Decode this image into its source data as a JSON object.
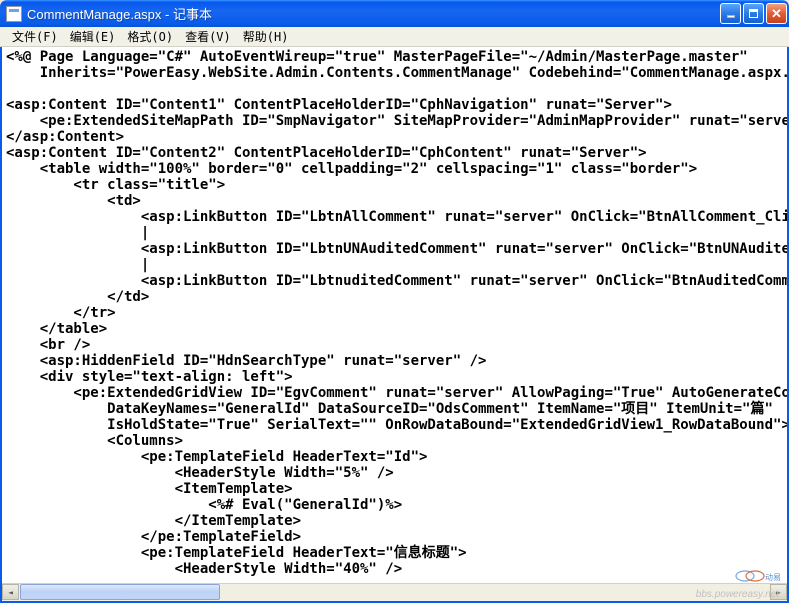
{
  "window": {
    "title": "CommentManage.aspx - 记事本"
  },
  "menu": {
    "file": "文件(F)",
    "edit": "编辑(E)",
    "format": "格式(O)",
    "view": "查看(V)",
    "help": "帮助(H)"
  },
  "buttons": {
    "min": "minimize",
    "max": "maximize",
    "close": "close"
  },
  "code_lines": [
    "<%@ Page Language=\"C#\" AutoEventWireup=\"true\" MasterPageFile=\"~/Admin/MasterPage.master\"",
    "    Inherits=\"PowerEasy.WebSite.Admin.Contents.CommentManage\" Codebehind=\"CommentManage.aspx.cs\"",
    "",
    "<asp:Content ID=\"Content1\" ContentPlaceHolderID=\"CphNavigation\" runat=\"Server\">",
    "    <pe:ExtendedSiteMapPath ID=\"SmpNavigator\" SiteMapProvider=\"AdminMapProvider\" runat=\"server\"",
    "</asp:Content>",
    "<asp:Content ID=\"Content2\" ContentPlaceHolderID=\"CphContent\" runat=\"Server\">",
    "    <table width=\"100%\" border=\"0\" cellpadding=\"2\" cellspacing=\"1\" class=\"border\">",
    "        <tr class=\"title\">",
    "            <td>",
    "                <asp:LinkButton ID=\"LbtnAllComment\" runat=\"server\" OnClick=\"BtnAllComment_Click\"",
    "                |",
    "                <asp:LinkButton ID=\"LbtnUNAuditedComment\" runat=\"server\" OnClick=\"BtnUNAuditedCo",
    "                |",
    "                <asp:LinkButton ID=\"LbtnuditedComment\" runat=\"server\" OnClick=\"BtnAuditedCommen",
    "            </td>",
    "        </tr>",
    "    </table>",
    "    <br />",
    "    <asp:HiddenField ID=\"HdnSearchType\" runat=\"server\" />",
    "    <div style=\"text-align: left\">",
    "        <pe:ExtendedGridView ID=\"EgvComment\" runat=\"server\" AllowPaging=\"True\" AutoGenerateColum",
    "            DataKeyNames=\"GeneralId\" DataSourceID=\"OdsComment\" ItemName=\"项目\" ItemUnit=\"篇\"",
    "            IsHoldState=\"True\" SerialText=\"\" OnRowDataBound=\"ExtendedGridView1_RowDataBound\">",
    "            <Columns>",
    "                <pe:TemplateField HeaderText=\"Id\">",
    "                    <HeaderStyle Width=\"5%\" />",
    "                    <ItemTemplate>",
    "                        <%# Eval(\"GeneralId\")%>",
    "                    </ItemTemplate>",
    "                </pe:TemplateField>",
    "                <pe:TemplateField HeaderText=\"信息标题\">",
    "                    <HeaderStyle Width=\"40%\" />"
  ],
  "watermark": "bbs.powereasy.net"
}
